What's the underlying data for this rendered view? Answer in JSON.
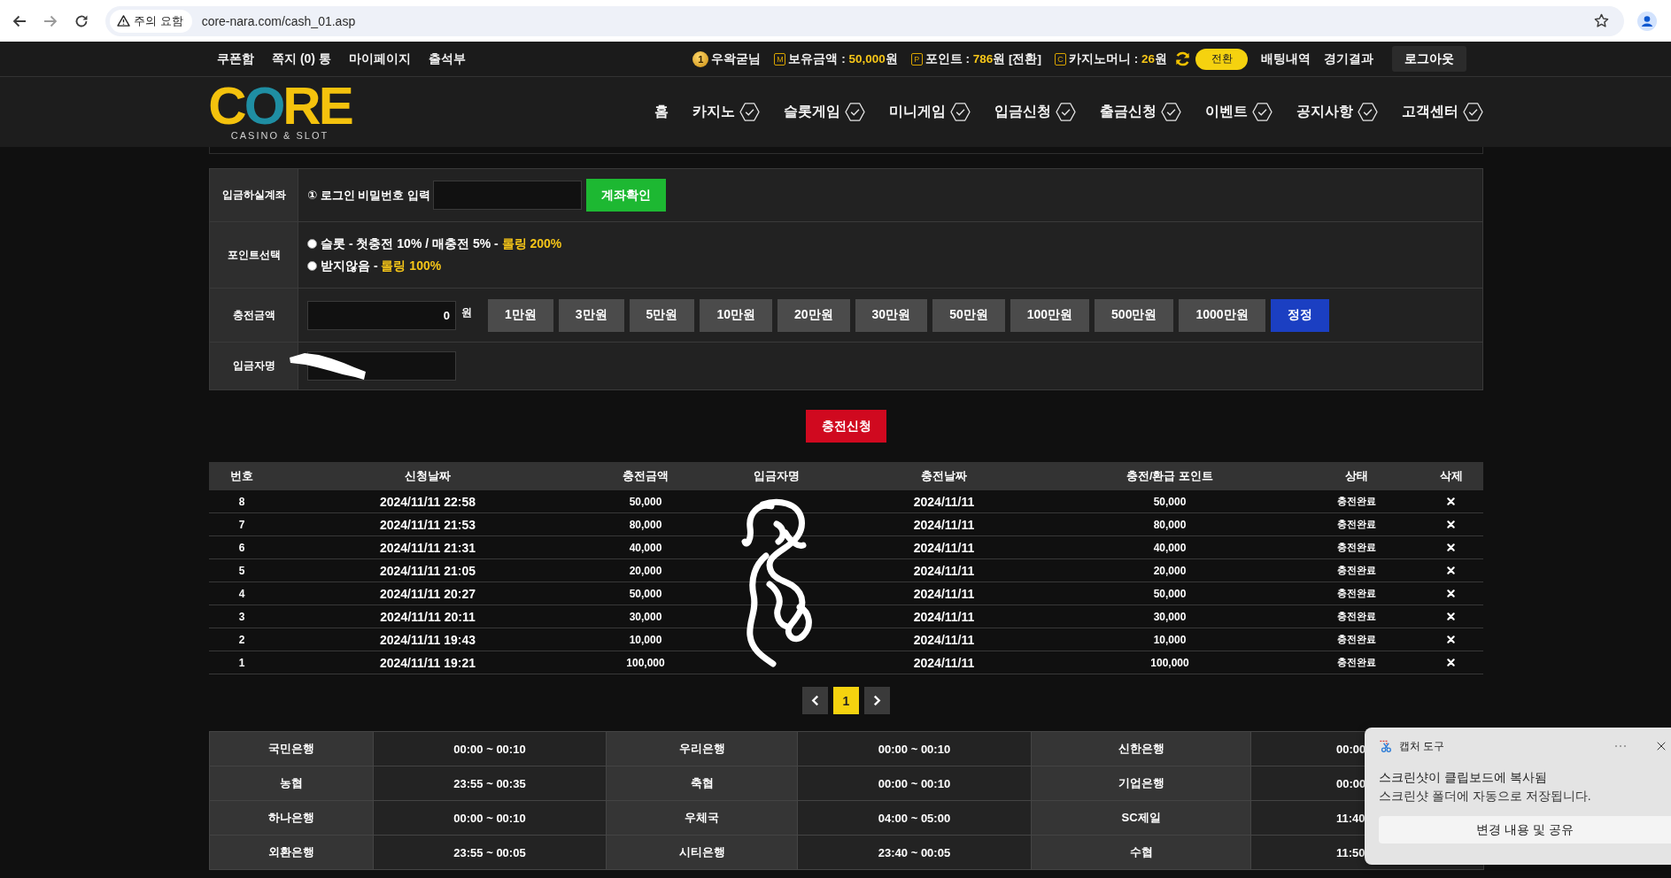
{
  "browser": {
    "security_label": "주의 요함",
    "url": "core-nara.com/cash_01.asp"
  },
  "top_bar": {
    "links": [
      "쿠폰함",
      "쪽지 (0) 통",
      "마이페이지",
      "출석부"
    ],
    "user": {
      "level": "1",
      "name": "우왁굳님"
    },
    "balances": [
      {
        "badge": "M",
        "label": "보유금액 :",
        "value": "50,000",
        "unit": "원"
      },
      {
        "badge": "P",
        "label": "포인트 :",
        "value": "786",
        "unit": "원 [전환]"
      },
      {
        "badge": "C",
        "label": "카지노머니 :",
        "value": "26",
        "unit": "원"
      }
    ],
    "convert_button": "전환",
    "links_right": [
      "배팅내역",
      "경기결과"
    ],
    "logout_button": "로그아웃"
  },
  "header": {
    "logo": {
      "text": "CORE",
      "tagline": "CASINO & SLOT"
    },
    "nav": [
      {
        "label": "홈",
        "kind": "plain"
      },
      {
        "label": "카지노",
        "kind": "menu"
      },
      {
        "label": "슬롯게임",
        "kind": "menu"
      },
      {
        "label": "미니게임",
        "kind": "menu"
      },
      {
        "label": "입금신청",
        "kind": "menu"
      },
      {
        "label": "출금신청",
        "kind": "menu"
      },
      {
        "label": "이벤트",
        "kind": "menu"
      },
      {
        "label": "공지사항",
        "kind": "menu"
      },
      {
        "label": "고객센터",
        "kind": "menu"
      }
    ]
  },
  "deposit_form": {
    "rows": [
      {
        "kind": "account",
        "label": "입금하실계좌",
        "prompt": "① 로그인 비밀번호 입력",
        "button": "계좌확인"
      },
      {
        "kind": "points",
        "label": "포인트선택",
        "options": [
          {
            "text": "슬롯 - 첫충전 10% / 매충전 5% -",
            "highlight": "롤링 200%",
            "selected": false
          },
          {
            "text": "받지않음 -",
            "highlight": "롤링 100%",
            "selected": false
          }
        ]
      },
      {
        "kind": "amount",
        "label": "충전금액",
        "value": "0",
        "unit": "원",
        "quick_amounts": [
          "1만원",
          "3만원",
          "5만원",
          "10만원",
          "20만원",
          "30만원",
          "50만원",
          "100만원",
          "500만원",
          "1000만원"
        ],
        "reset_button": "정정"
      },
      {
        "kind": "name",
        "label": "입금자명"
      }
    ],
    "submit_button": "충전신청"
  },
  "history": {
    "columns": [
      "번호",
      "신청날짜",
      "충전금액",
      "입금자명",
      "충전날짜",
      "충전/환급 포인트",
      "상태",
      "삭제"
    ],
    "rows": [
      {
        "no": "8",
        "requested": "2024/11/11 22:58",
        "amount": "50,000",
        "charged": "2024/11/11",
        "points": "50,000",
        "status": "충전완료"
      },
      {
        "no": "7",
        "requested": "2024/11/11 21:53",
        "amount": "80,000",
        "charged": "2024/11/11",
        "points": "80,000",
        "status": "충전완료"
      },
      {
        "no": "6",
        "requested": "2024/11/11 21:31",
        "amount": "40,000",
        "charged": "2024/11/11",
        "points": "40,000",
        "status": "충전완료"
      },
      {
        "no": "5",
        "requested": "2024/11/11 21:05",
        "amount": "20,000",
        "charged": "2024/11/11",
        "points": "20,000",
        "status": "충전완료"
      },
      {
        "no": "4",
        "requested": "2024/11/11 20:27",
        "amount": "50,000",
        "charged": "2024/11/11",
        "points": "50,000",
        "status": "충전완료"
      },
      {
        "no": "3",
        "requested": "2024/11/11 20:11",
        "amount": "30,000",
        "charged": "2024/11/11",
        "points": "30,000",
        "status": "충전완료"
      },
      {
        "no": "2",
        "requested": "2024/11/11 19:43",
        "amount": "10,000",
        "charged": "2024/11/11",
        "points": "10,000",
        "status": "충전완료"
      },
      {
        "no": "1",
        "requested": "2024/11/11 19:21",
        "amount": "100,000",
        "charged": "2024/11/11",
        "points": "100,000",
        "status": "충전완료"
      }
    ]
  },
  "pagination": {
    "pages": [
      {
        "label": "1",
        "selected": true
      }
    ]
  },
  "bank_hours": {
    "rows": [
      [
        {
          "bank": "국민은행",
          "hours": "00:00 ~ 00:10"
        },
        {
          "bank": "우리은행",
          "hours": "00:00 ~ 00:10"
        },
        {
          "bank": "신한은행",
          "hours": "00:00"
        }
      ],
      [
        {
          "bank": "농협",
          "hours": "23:55 ~ 00:35"
        },
        {
          "bank": "축협",
          "hours": "00:00 ~ 00:10"
        },
        {
          "bank": "기업은행",
          "hours": "00:00"
        }
      ],
      [
        {
          "bank": "하나은행",
          "hours": "00:00 ~ 00:10"
        },
        {
          "bank": "우체국",
          "hours": "04:00 ~ 05:00"
        },
        {
          "bank": "SC제일",
          "hours": "11:40"
        }
      ],
      [
        {
          "bank": "외환은행",
          "hours": "23:55 ~ 00:05"
        },
        {
          "bank": "시티은행",
          "hours": "23:40 ~ 00:05"
        },
        {
          "bank": "수협",
          "hours": "11:50"
        }
      ]
    ]
  },
  "toast": {
    "app": "캡처 도구",
    "lines": [
      "스크린샷이 클립보드에 복사됨",
      "스크린샷 폴더에 자동으로 저장됩니다."
    ],
    "button": "변경 내용 및 공유"
  }
}
